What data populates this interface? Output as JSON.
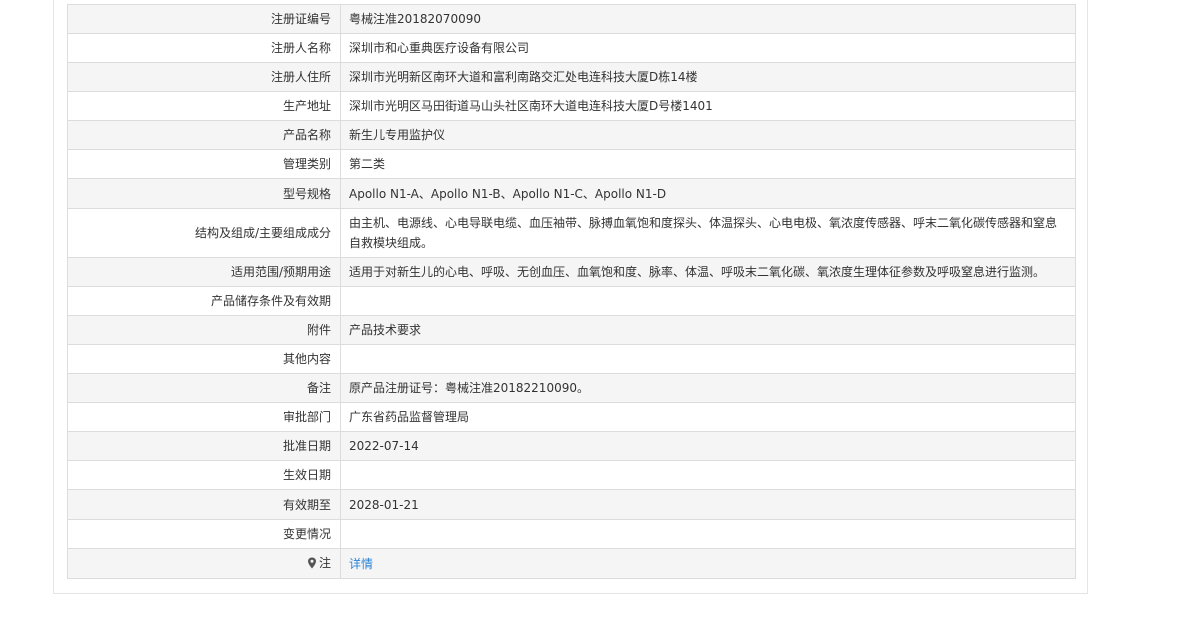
{
  "rows": [
    {
      "label": "注册证编号",
      "value": "粤械注准20182070090"
    },
    {
      "label": "注册人名称",
      "value": "深圳市和心重典医疗设备有限公司"
    },
    {
      "label": "注册人住所",
      "value": "深圳市光明新区南环大道和富利南路交汇处电连科技大厦D栋14楼"
    },
    {
      "label": "生产地址",
      "value": "深圳市光明区马田街道马山头社区南环大道电连科技大厦D号楼1401"
    },
    {
      "label": "产品名称",
      "value": "新生儿专用监护仪"
    },
    {
      "label": "管理类别",
      "value": "第二类"
    },
    {
      "label": "型号规格",
      "value": "Apollo N1-A、Apollo N1-B、Apollo N1-C、Apollo N1-D"
    },
    {
      "label": "结构及组成/主要组成成分",
      "value": "由主机、电源线、心电导联电缆、血压袖带、脉搏血氧饱和度探头、体温探头、心电电极、氧浓度传感器、呼末二氧化碳传感器和窒息自救模块组成。"
    },
    {
      "label": "适用范围/预期用途",
      "value": "适用于对新生儿的心电、呼吸、无创血压、血氧饱和度、脉率、体温、呼吸末二氧化碳、氧浓度生理体征参数及呼吸窒息进行监测。"
    },
    {
      "label": "产品储存条件及有效期",
      "value": ""
    },
    {
      "label": "附件",
      "value": "产品技术要求"
    },
    {
      "label": "其他内容",
      "value": ""
    },
    {
      "label": "备注",
      "value": "原产品注册证号：粤械注准20182210090。"
    },
    {
      "label": "审批部门",
      "value": "广东省药品监督管理局"
    },
    {
      "label": "批准日期",
      "value": "2022-07-14"
    },
    {
      "label": "生效日期",
      "value": ""
    },
    {
      "label": "有效期至",
      "value": "2028-01-21"
    },
    {
      "label": "变更情况",
      "value": ""
    }
  ],
  "note": {
    "label": "注",
    "icon": "map-pin-icon",
    "link_text": "详情"
  },
  "colors": {
    "link": "#2a84d8",
    "stripe": "#f5f5f5",
    "border": "#dcdcdc"
  }
}
